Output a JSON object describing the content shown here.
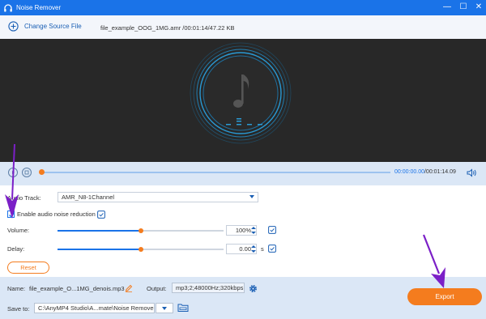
{
  "window": {
    "title": "Noise Remover",
    "controls": {
      "minimize": "—",
      "maximize": "☐",
      "close": "✕"
    }
  },
  "toolbar": {
    "change_source_label": "Change Source File",
    "file_name": "file_example_OOG_1MG.amr",
    "file_meta": "/00:01:14/47.22 KB"
  },
  "player": {
    "current_time": "00:00:00.00",
    "total_time": "/00:01:14.09",
    "progress": 0
  },
  "settings": {
    "audio_track_label": "Audio Track:",
    "audio_track_value": "AMR_N8-1Channel",
    "enable_reduction_label": "Enable audio noise reduction",
    "enable_reduction_checked": true,
    "volume_label": "Volume:",
    "volume_value": "100%",
    "volume_level": 0.5,
    "delay_label": "Delay:",
    "delay_value": "0.00",
    "delay_unit": "s",
    "delay_level": 0.5,
    "reset_label": "Reset"
  },
  "output": {
    "name_label": "Name:",
    "name_value": "file_example_O...1MG_denois.mp3",
    "output_label": "Output:",
    "output_value": "mp3;2;48000Hz;320kbps",
    "save_to_label": "Save to:",
    "save_to_value": "C:\\AnyMP4 Studio\\A...mate\\Noise Remover",
    "export_label": "Export"
  },
  "colors": {
    "titlebar": "#1a73e8",
    "accent": "#f47c1e",
    "annotation_arrow": "#7b1fc7"
  },
  "icons": [
    "headphones-icon",
    "plus-circle-icon",
    "music-note-icon",
    "play-icon",
    "stop-icon",
    "volume-icon",
    "copy-icon",
    "edit-icon",
    "gear-icon",
    "folder-icon"
  ]
}
